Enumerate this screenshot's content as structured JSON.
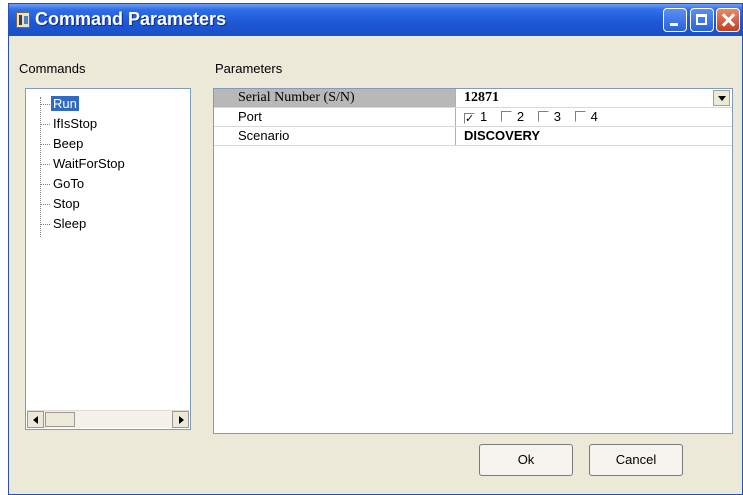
{
  "window": {
    "title": "Command Parameters"
  },
  "labels": {
    "commands": "Commands",
    "parameters": "Parameters"
  },
  "commands": [
    {
      "label": "Run",
      "selected": true
    },
    {
      "label": "IfIsStop",
      "selected": false
    },
    {
      "label": "Beep",
      "selected": false
    },
    {
      "label": "WaitForStop",
      "selected": false
    },
    {
      "label": "GoTo",
      "selected": false
    },
    {
      "label": "Stop",
      "selected": false
    },
    {
      "label": "Sleep",
      "selected": false
    }
  ],
  "parameters": {
    "serial_number": {
      "key": "Serial Number (S/N)",
      "value": "12871"
    },
    "port": {
      "key": "Port",
      "options": [
        {
          "label": "1",
          "checked": true
        },
        {
          "label": "2",
          "checked": false
        },
        {
          "label": "3",
          "checked": false
        },
        {
          "label": "4",
          "checked": false
        }
      ]
    },
    "scenario": {
      "key": "Scenario",
      "value": "DISCOVERY"
    }
  },
  "buttons": {
    "ok": "Ok",
    "cancel": "Cancel"
  },
  "colors": {
    "titlebar": "#1e58d6",
    "selection": "#316ac5",
    "dialog": "#ece9d8"
  },
  "icons": [
    "app-icon",
    "minimize-icon",
    "maximize-icon",
    "close-icon",
    "dropdown-arrow-icon",
    "scroll-left-icon",
    "scroll-right-icon"
  ]
}
